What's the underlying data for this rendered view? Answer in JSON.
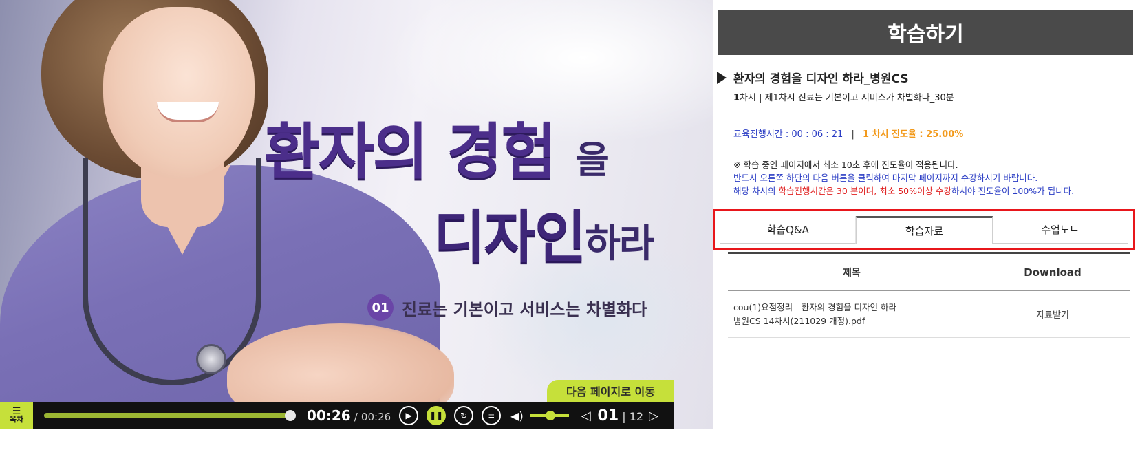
{
  "video": {
    "title_line1": "환자의 경험",
    "title_line1_suffix": "을",
    "title_line2": "디자인",
    "title_line2_suffix": "하라",
    "subtitle_number": "01",
    "subtitle_text": "진료는 기본이고 서비스는 차별화다",
    "next_page_label": "다음 페이지로 이동"
  },
  "controls": {
    "toc_label": "목차",
    "progress_fraction": 1.0,
    "current_time": "00:26",
    "separator": "/",
    "total_time": "00:26",
    "current_page": "01",
    "page_divider": "|",
    "total_pages": "12",
    "accent_color": "#c6e03a"
  },
  "panel": {
    "header": "학습하기",
    "course_title": "환자의 경험을 디자인 하라_병원CS",
    "session_bold": "1",
    "session_text": "차시 | 제1차시 진료는 기본이고 서비스가 차별화다_30분",
    "elapsed_label": "교육진행시간 : 00 : 06 : 21",
    "divider": "|",
    "progress_label": "1 차시 진도율 : 25.00%",
    "note1": "※ 학습 중인 페이지에서 최소 10초 후에 진도율이 적용됩니다.",
    "note2": "반드시 오른쪽 하단의 다음 버튼을 클릭하여 마지막 페이지까지 수강하시기 바랍니다.",
    "note3_a": "해당 차시의 ",
    "note3_red": "학습진행시간은 30 분이며, 최소 50%이상 수강",
    "note3_b": "하셔야 진도율이 100%가 됩니다.",
    "tabs": [
      {
        "label": "학습Q&A"
      },
      {
        "label": "학습자료"
      },
      {
        "label": "수업노트"
      }
    ],
    "table": {
      "col_title": "제목",
      "col_download": "Download",
      "rows": [
        {
          "title_line1": "cou(1)요점정리 - 환자의 경험을 디자인 하라",
          "title_line2": "병원CS 14차시(211029 개정).pdf",
          "download": "자료받기"
        }
      ]
    }
  }
}
